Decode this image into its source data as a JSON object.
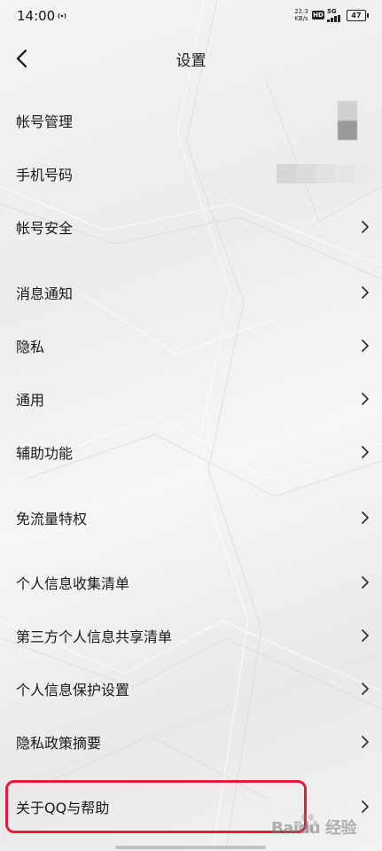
{
  "status_bar": {
    "time": "14:00",
    "net_speed": "22.3 KB/s",
    "hd": "HD",
    "net_type": "5G",
    "battery": "47",
    "hotspot_icon": "hotspot-icon",
    "signal_icon": "signal-icon",
    "battery_icon": "battery-icon"
  },
  "nav": {
    "title": "设置",
    "back_icon": "chevron-left-icon"
  },
  "rows": [
    {
      "label": "帐号管理"
    },
    {
      "label": "手机号码"
    },
    {
      "label": "帐号安全"
    },
    {
      "label": "消息通知"
    },
    {
      "label": "隐私"
    },
    {
      "label": "通用"
    },
    {
      "label": "辅助功能"
    },
    {
      "label": "免流量特权"
    },
    {
      "label": "个人信息收集清单"
    },
    {
      "label": "第三方个人信息共享清单"
    },
    {
      "label": "个人信息保护设置"
    },
    {
      "label": "隐私政策摘要"
    },
    {
      "label": "关于QQ与帮助"
    }
  ],
  "highlight_color": "#e11d3f",
  "watermark": "Baidu 经验"
}
